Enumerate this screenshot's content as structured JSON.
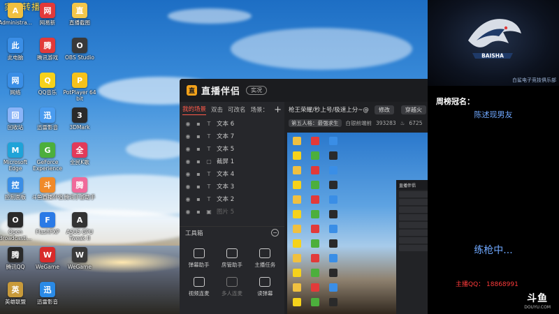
{
  "desktop": {
    "corner_text": "实况转播斗",
    "icons": [
      {
        "label": "Administra...",
        "icon": "user-folder-icon",
        "color": "#f0c040"
      },
      {
        "label": "网易新",
        "icon": "netease-icon",
        "color": "#e23a3a"
      },
      {
        "label": "直播截图",
        "icon": "screenshot-folder-icon",
        "color": "#f3c64a"
      },
      {
        "label": "此电脑",
        "icon": "this-pc-icon",
        "color": "#3a8ee6"
      },
      {
        "label": "腾讯游戏",
        "icon": "tencent-games-icon",
        "color": "#e23a3a"
      },
      {
        "label": "OBS Studio",
        "icon": "obs-icon",
        "color": "#3a3a3a"
      },
      {
        "label": "网络",
        "icon": "network-icon",
        "color": "#3a8ee6"
      },
      {
        "label": "QQ音乐",
        "icon": "qq-music-icon",
        "color": "#f6d21b"
      },
      {
        "label": "PotPlayer 64 bit",
        "icon": "potplayer-icon",
        "color": "#f6c21b"
      },
      {
        "label": "回收站",
        "icon": "recycle-bin-icon",
        "color": "#8ab4f8"
      },
      {
        "label": "迅雷影音",
        "icon": "thunder-player-icon",
        "color": "#4a9cf0"
      },
      {
        "label": "3DMark",
        "icon": "3dmark-icon",
        "color": "#2a2a2a"
      },
      {
        "label": "Microsoft Edge",
        "icon": "edge-icon",
        "color": "#1fa3d8"
      },
      {
        "label": "GeForce Experience",
        "icon": "geforce-icon",
        "color": "#4caf3c"
      },
      {
        "label": "全民K歌",
        "icon": "karaoke-icon",
        "color": "#e23a5a"
      },
      {
        "label": "控制面板",
        "icon": "control-panel-icon",
        "color": "#3a8ee6"
      },
      {
        "label": "斗鱼直播伴侣",
        "icon": "douyu-companion-icon",
        "color": "#f08a2a"
      },
      {
        "label": "腾讯手游助手",
        "icon": "mobile-games-icon",
        "color": "#f06a9a"
      },
      {
        "label": "Open Broadcasti...",
        "icon": "open-broadcaster-icon",
        "color": "#2a2a2a"
      },
      {
        "label": "FlashFXP",
        "icon": "flashfxp-icon",
        "color": "#2a7ae6"
      },
      {
        "label": "ASUS GPU Tweak II",
        "icon": "asus-gpu-icon",
        "color": "#333333"
      },
      {
        "label": "腾讯QQ",
        "icon": "qq-icon",
        "color": "#2a2a2a"
      },
      {
        "label": "WeGame",
        "icon": "wegame-icon",
        "color": "#d82a2a"
      },
      {
        "label": "WeGame",
        "icon": "wegame-icon",
        "color": "#3a3a3a"
      },
      {
        "label": "英雄联盟",
        "icon": "lol-icon",
        "color": "#c89a3a"
      },
      {
        "label": "迅雷影音",
        "icon": "thunder-icon",
        "color": "#2a8ae6"
      }
    ]
  },
  "app": {
    "name": "直播伴侣",
    "badge": "实况",
    "tabs": [
      "我的场景",
      "双击",
      "可改名",
      "场景："
    ],
    "add_symbol": "+",
    "sources": [
      {
        "label": "文本 6",
        "type": "T"
      },
      {
        "label": "文本 7",
        "type": "T"
      },
      {
        "label": "文本 5",
        "type": "T"
      },
      {
        "label": "截屏 1",
        "type": "▢"
      },
      {
        "label": "文本 4",
        "type": "T"
      },
      {
        "label": "文本 3",
        "type": "T"
      },
      {
        "label": "文本 2",
        "type": "T"
      },
      {
        "label": "图片 5",
        "type": "▣",
        "dim": true
      }
    ],
    "toolbox_title": "工具箱",
    "tools": [
      {
        "label": "弹幕助手"
      },
      {
        "label": "房管助手"
      },
      {
        "label": "主播任务"
      },
      {
        "label": "视频连麦"
      },
      {
        "label": "多人连麦",
        "dim": true
      },
      {
        "label": "读弹幕"
      }
    ],
    "preview": {
      "title": "枪王荣耀/秒上号/极速上分~@",
      "edit_label": "修改",
      "category_label": "穿越火",
      "sub_badge": "第五人格：最强求生",
      "sub_text": "白银前端前",
      "viewers": "393283",
      "hot": "6725"
    }
  },
  "side": {
    "logo_text": "BAISHA",
    "club": "白鲨电子竞技俱乐部",
    "rank_title": "周榜冠名：",
    "rank_name": "陈述现男友",
    "practice": "练枪中...",
    "qq": "主播QQ：  18868991",
    "brand": "斗鱼",
    "brand_sub": "DOUYU.COM"
  }
}
